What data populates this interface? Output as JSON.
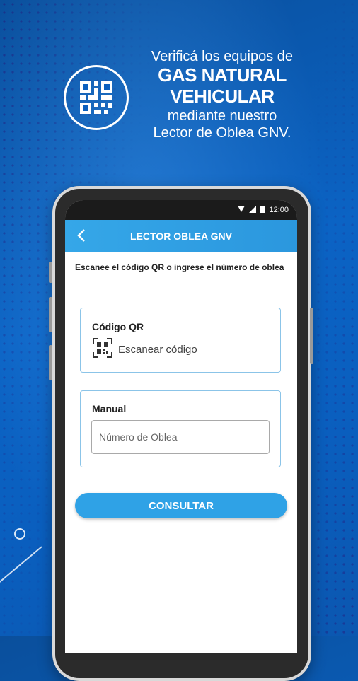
{
  "promo": {
    "line1": "Verificá los equipos de",
    "line2": "GAS NATURAL",
    "line3": "VEHICULAR",
    "line4": "mediante nuestro",
    "line5": "Lector de Oblea GNV."
  },
  "status_bar": {
    "time": "12:00"
  },
  "app_bar": {
    "title": "LECTOR OBLEA GNV"
  },
  "instruction": "Escanee el código QR o ingrese el número de oblea",
  "qr_card": {
    "title": "Código QR",
    "scan_label": "Escanear código"
  },
  "manual_card": {
    "title": "Manual",
    "input_placeholder": "Número de Oblea",
    "input_value": ""
  },
  "submit": {
    "label": "CONSULTAR"
  },
  "colors": {
    "accent": "#2fa2e6",
    "background": "#0b63c4",
    "card_border": "#8bc4e8"
  }
}
